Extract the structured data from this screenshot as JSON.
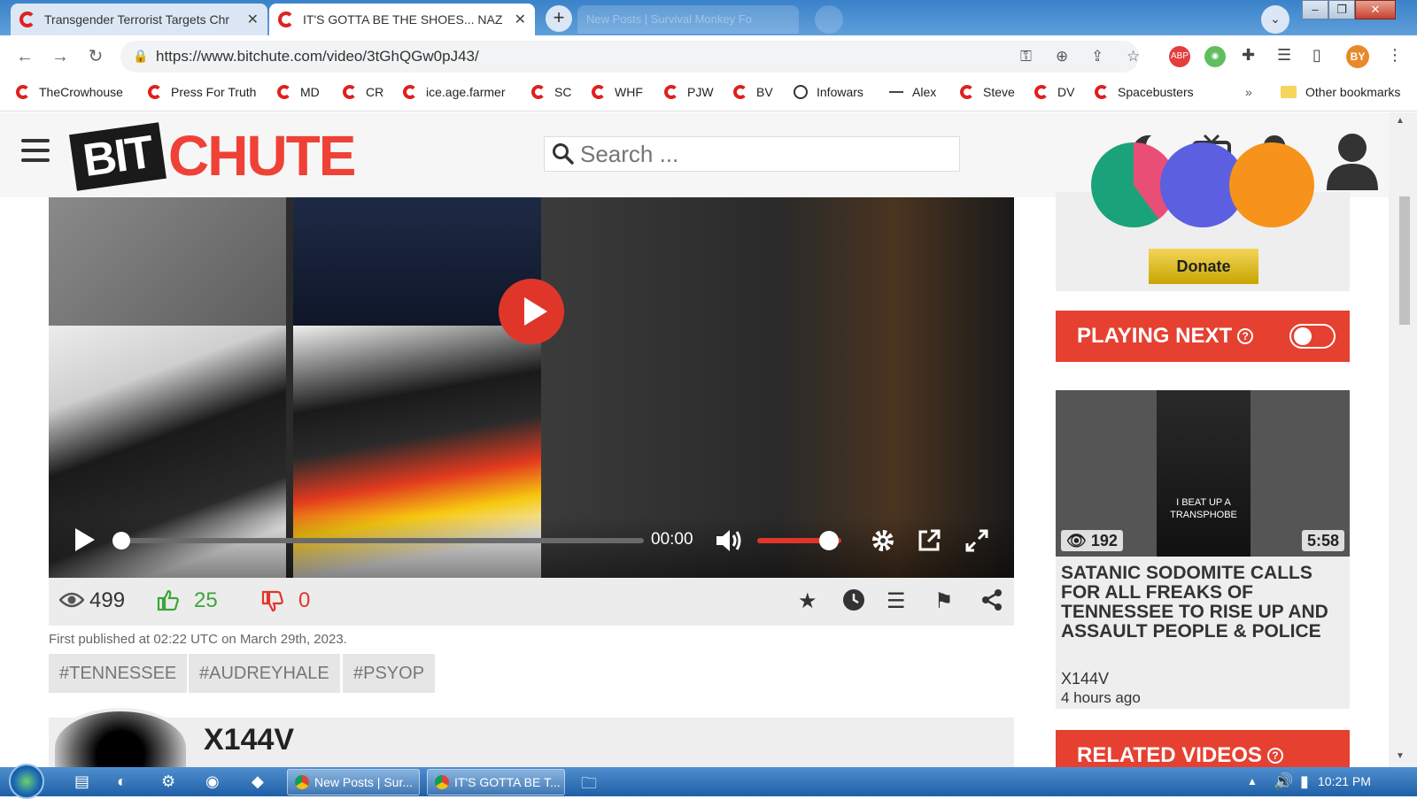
{
  "browser": {
    "tabs": [
      {
        "title": "Transgender Terrorist Targets Chr",
        "active": false
      },
      {
        "title": "IT'S GOTTA BE THE SHOES... NAZ",
        "active": true
      }
    ],
    "background_tab": "New Posts | Survival Monkey Fo",
    "url": "https://www.bitchute.com/video/3tGhQGw0pJ43/",
    "profile_initials": "BY",
    "extensions": {
      "adblock": "ABP"
    },
    "bookmarks": [
      {
        "label": "TheCrowhouse",
        "icon": "bitchute"
      },
      {
        "label": "Press For Truth",
        "icon": "bitchute"
      },
      {
        "label": "MD",
        "icon": "bitchute"
      },
      {
        "label": "CR",
        "icon": "bitchute"
      },
      {
        "label": "ice.age.farmer",
        "icon": "bitchute"
      },
      {
        "label": "SC",
        "icon": "bitchute"
      },
      {
        "label": "WHF",
        "icon": "bitchute"
      },
      {
        "label": "PJW",
        "icon": "bitchute"
      },
      {
        "label": "BV",
        "icon": "bitchute"
      },
      {
        "label": "Infowars",
        "icon": "globe"
      },
      {
        "label": "Alex",
        "icon": "dash"
      },
      {
        "label": "Steve",
        "icon": "bitchute"
      },
      {
        "label": "DV",
        "icon": "bitchute"
      },
      {
        "label": "Spacebusters",
        "icon": "bitchute"
      }
    ],
    "overflow": "»",
    "other_bookmarks": "Other bookmarks"
  },
  "site": {
    "logo_bit": "BIT",
    "logo_chute": "CHUTE",
    "search_placeholder": "Search ..."
  },
  "player": {
    "time": "00:00",
    "progress": 0,
    "volume": 0.85
  },
  "stats": {
    "views": "499",
    "likes": "25",
    "dislikes": "0",
    "published": "First published at 02:22 UTC on March 29th, 2023."
  },
  "tags": [
    "#TENNESSEE",
    "#AUDREYHALE",
    "#PSYOP"
  ],
  "channel": {
    "name": "X144V"
  },
  "sidebar": {
    "donate_label": "Donate",
    "playing_next_label": "PLAYING NEXT",
    "autoplay_on": false,
    "next_video": {
      "thumb_caption": "I BEAT UP A TRANSPHOBE",
      "views": "192",
      "duration": "5:58",
      "title": "SATANIC SODOMITE CALLS FOR ALL FREAKS OF TENNESSEE TO RISE UP AND ASSAULT PEOPLE & POLICE",
      "channel": "X144V",
      "age": "4 hours ago"
    },
    "related_label": "RELATED VIDEOS"
  },
  "taskbar": {
    "buttons": [
      "New Posts | Sur...",
      "IT'S GOTTA BE T..."
    ],
    "time": "10:21 PM"
  },
  "colors": {
    "brand_red": "#ef4136",
    "like_green": "#3aa63a",
    "dislike_red": "#e0362a"
  }
}
